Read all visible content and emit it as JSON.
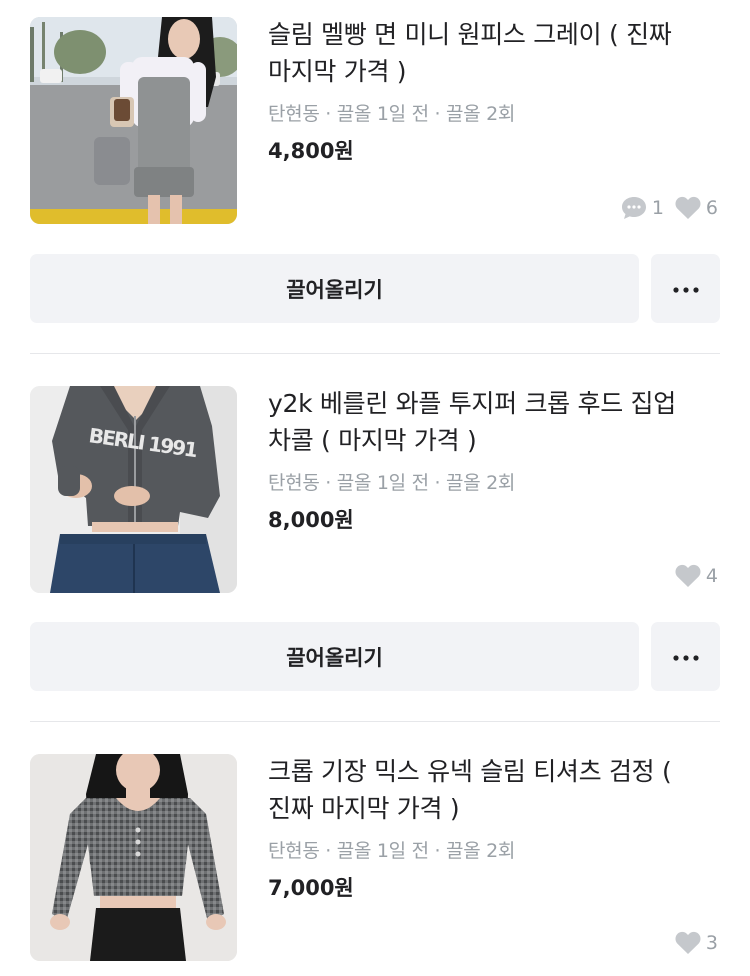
{
  "listings": [
    {
      "title": "슬림 멜빵 면 미니 원피스 그레이 ( 진짜 마지막 가격 )",
      "location": "탄현동",
      "bumped_time": "끌올 1일 전",
      "bump_count": "끌올 2회",
      "meta_sep": "·",
      "price": "4,800원",
      "comments": "1",
      "likes": "6"
    },
    {
      "title": "y2k 베를린 와플 투지퍼 크롭 후드 집업 차콜 ( 마지막 가격 )",
      "location": "탄현동",
      "bumped_time": "끌올 1일 전",
      "bump_count": "끌올 2회",
      "meta_sep": "·",
      "price": "8,000원",
      "likes": "4",
      "hoodie_print": "BERLI 1991"
    },
    {
      "title": "크롭 기장 믹스 유넥 슬림 티셔츠 검정 ( 진짜 마지막 가격 )",
      "location": "탄현동",
      "bumped_time": "끌올 1일 전",
      "bump_count": "끌올 2회",
      "meta_sep": "·",
      "price": "7,000원",
      "likes": "3"
    }
  ],
  "actions": {
    "bump_label": "끌어올리기",
    "more_label": "···"
  },
  "icons": {
    "comment": "comment-bubble-icon",
    "like": "heart-icon",
    "more": "more-dots-icon"
  },
  "colors": {
    "text": "#212124",
    "muted": "#9aa0a6",
    "button_bg": "#f2f3f6",
    "divider": "#e6e7ea"
  }
}
